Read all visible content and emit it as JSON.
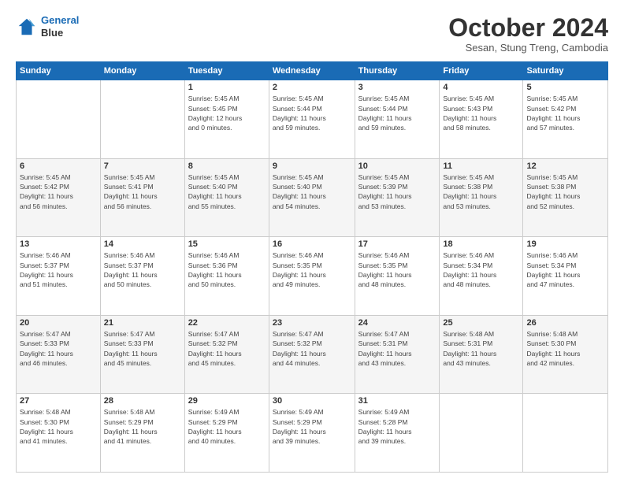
{
  "header": {
    "logo_line1": "General",
    "logo_line2": "Blue",
    "title": "October 2024",
    "subtitle": "Sesan, Stung Treng, Cambodia"
  },
  "weekdays": [
    "Sunday",
    "Monday",
    "Tuesday",
    "Wednesday",
    "Thursday",
    "Friday",
    "Saturday"
  ],
  "weeks": [
    [
      {
        "day": "",
        "info": ""
      },
      {
        "day": "",
        "info": ""
      },
      {
        "day": "1",
        "info": "Sunrise: 5:45 AM\nSunset: 5:45 PM\nDaylight: 12 hours\nand 0 minutes."
      },
      {
        "day": "2",
        "info": "Sunrise: 5:45 AM\nSunset: 5:44 PM\nDaylight: 11 hours\nand 59 minutes."
      },
      {
        "day": "3",
        "info": "Sunrise: 5:45 AM\nSunset: 5:44 PM\nDaylight: 11 hours\nand 59 minutes."
      },
      {
        "day": "4",
        "info": "Sunrise: 5:45 AM\nSunset: 5:43 PM\nDaylight: 11 hours\nand 58 minutes."
      },
      {
        "day": "5",
        "info": "Sunrise: 5:45 AM\nSunset: 5:42 PM\nDaylight: 11 hours\nand 57 minutes."
      }
    ],
    [
      {
        "day": "6",
        "info": "Sunrise: 5:45 AM\nSunset: 5:42 PM\nDaylight: 11 hours\nand 56 minutes."
      },
      {
        "day": "7",
        "info": "Sunrise: 5:45 AM\nSunset: 5:41 PM\nDaylight: 11 hours\nand 56 minutes."
      },
      {
        "day": "8",
        "info": "Sunrise: 5:45 AM\nSunset: 5:40 PM\nDaylight: 11 hours\nand 55 minutes."
      },
      {
        "day": "9",
        "info": "Sunrise: 5:45 AM\nSunset: 5:40 PM\nDaylight: 11 hours\nand 54 minutes."
      },
      {
        "day": "10",
        "info": "Sunrise: 5:45 AM\nSunset: 5:39 PM\nDaylight: 11 hours\nand 53 minutes."
      },
      {
        "day": "11",
        "info": "Sunrise: 5:45 AM\nSunset: 5:38 PM\nDaylight: 11 hours\nand 53 minutes."
      },
      {
        "day": "12",
        "info": "Sunrise: 5:45 AM\nSunset: 5:38 PM\nDaylight: 11 hours\nand 52 minutes."
      }
    ],
    [
      {
        "day": "13",
        "info": "Sunrise: 5:46 AM\nSunset: 5:37 PM\nDaylight: 11 hours\nand 51 minutes."
      },
      {
        "day": "14",
        "info": "Sunrise: 5:46 AM\nSunset: 5:37 PM\nDaylight: 11 hours\nand 50 minutes."
      },
      {
        "day": "15",
        "info": "Sunrise: 5:46 AM\nSunset: 5:36 PM\nDaylight: 11 hours\nand 50 minutes."
      },
      {
        "day": "16",
        "info": "Sunrise: 5:46 AM\nSunset: 5:35 PM\nDaylight: 11 hours\nand 49 minutes."
      },
      {
        "day": "17",
        "info": "Sunrise: 5:46 AM\nSunset: 5:35 PM\nDaylight: 11 hours\nand 48 minutes."
      },
      {
        "day": "18",
        "info": "Sunrise: 5:46 AM\nSunset: 5:34 PM\nDaylight: 11 hours\nand 48 minutes."
      },
      {
        "day": "19",
        "info": "Sunrise: 5:46 AM\nSunset: 5:34 PM\nDaylight: 11 hours\nand 47 minutes."
      }
    ],
    [
      {
        "day": "20",
        "info": "Sunrise: 5:47 AM\nSunset: 5:33 PM\nDaylight: 11 hours\nand 46 minutes."
      },
      {
        "day": "21",
        "info": "Sunrise: 5:47 AM\nSunset: 5:33 PM\nDaylight: 11 hours\nand 45 minutes."
      },
      {
        "day": "22",
        "info": "Sunrise: 5:47 AM\nSunset: 5:32 PM\nDaylight: 11 hours\nand 45 minutes."
      },
      {
        "day": "23",
        "info": "Sunrise: 5:47 AM\nSunset: 5:32 PM\nDaylight: 11 hours\nand 44 minutes."
      },
      {
        "day": "24",
        "info": "Sunrise: 5:47 AM\nSunset: 5:31 PM\nDaylight: 11 hours\nand 43 minutes."
      },
      {
        "day": "25",
        "info": "Sunrise: 5:48 AM\nSunset: 5:31 PM\nDaylight: 11 hours\nand 43 minutes."
      },
      {
        "day": "26",
        "info": "Sunrise: 5:48 AM\nSunset: 5:30 PM\nDaylight: 11 hours\nand 42 minutes."
      }
    ],
    [
      {
        "day": "27",
        "info": "Sunrise: 5:48 AM\nSunset: 5:30 PM\nDaylight: 11 hours\nand 41 minutes."
      },
      {
        "day": "28",
        "info": "Sunrise: 5:48 AM\nSunset: 5:29 PM\nDaylight: 11 hours\nand 41 minutes."
      },
      {
        "day": "29",
        "info": "Sunrise: 5:49 AM\nSunset: 5:29 PM\nDaylight: 11 hours\nand 40 minutes."
      },
      {
        "day": "30",
        "info": "Sunrise: 5:49 AM\nSunset: 5:29 PM\nDaylight: 11 hours\nand 39 minutes."
      },
      {
        "day": "31",
        "info": "Sunrise: 5:49 AM\nSunset: 5:28 PM\nDaylight: 11 hours\nand 39 minutes."
      },
      {
        "day": "",
        "info": ""
      },
      {
        "day": "",
        "info": ""
      }
    ]
  ]
}
